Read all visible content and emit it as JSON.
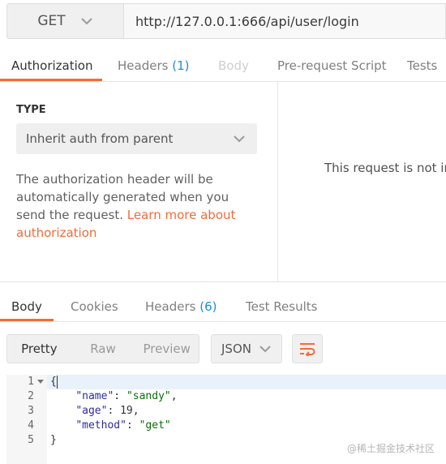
{
  "request": {
    "method": "GET",
    "url": "http://127.0.0.1:666/api/user/login"
  },
  "request_tabs": [
    {
      "label": "Authorization",
      "state": "active"
    },
    {
      "label": "Headers",
      "count": "(1)"
    },
    {
      "label": "Body",
      "state": "disabled"
    },
    {
      "label": "Pre-request Script"
    },
    {
      "label": "Tests"
    }
  ],
  "auth": {
    "type_label": "TYPE",
    "selected_type": "Inherit auth from parent",
    "description": "The authorization header will be automatically generated when you send the request.",
    "link_text": "Learn more about authorization",
    "right_message": "This request is not inh"
  },
  "response_tabs": [
    {
      "label": "Body",
      "state": "active"
    },
    {
      "label": "Cookies"
    },
    {
      "label": "Headers",
      "count": "(6)"
    },
    {
      "label": "Test Results"
    }
  ],
  "toolbar": {
    "views": [
      "Pretty",
      "Raw",
      "Preview"
    ],
    "active_view": "Pretty",
    "format": "JSON",
    "wrap_icon": "wrap-lines-icon"
  },
  "code": {
    "line_numbers": [
      "1",
      "2",
      "3",
      "4",
      "5"
    ],
    "lines": {
      "l1": "{",
      "l2_key": "\"name\"",
      "l2_val": "\"sandy\"",
      "l3_key": "\"age\"",
      "l3_val": "19",
      "l4_key": "\"method\"",
      "l4_val": "\"get\"",
      "l5": "}"
    }
  },
  "watermark": "@稀土掘金技术社区",
  "colors": {
    "accent": "#f26b3a",
    "count": "#1f8ecf",
    "string": "#0b6e0b",
    "key": "#2b2b9e"
  }
}
